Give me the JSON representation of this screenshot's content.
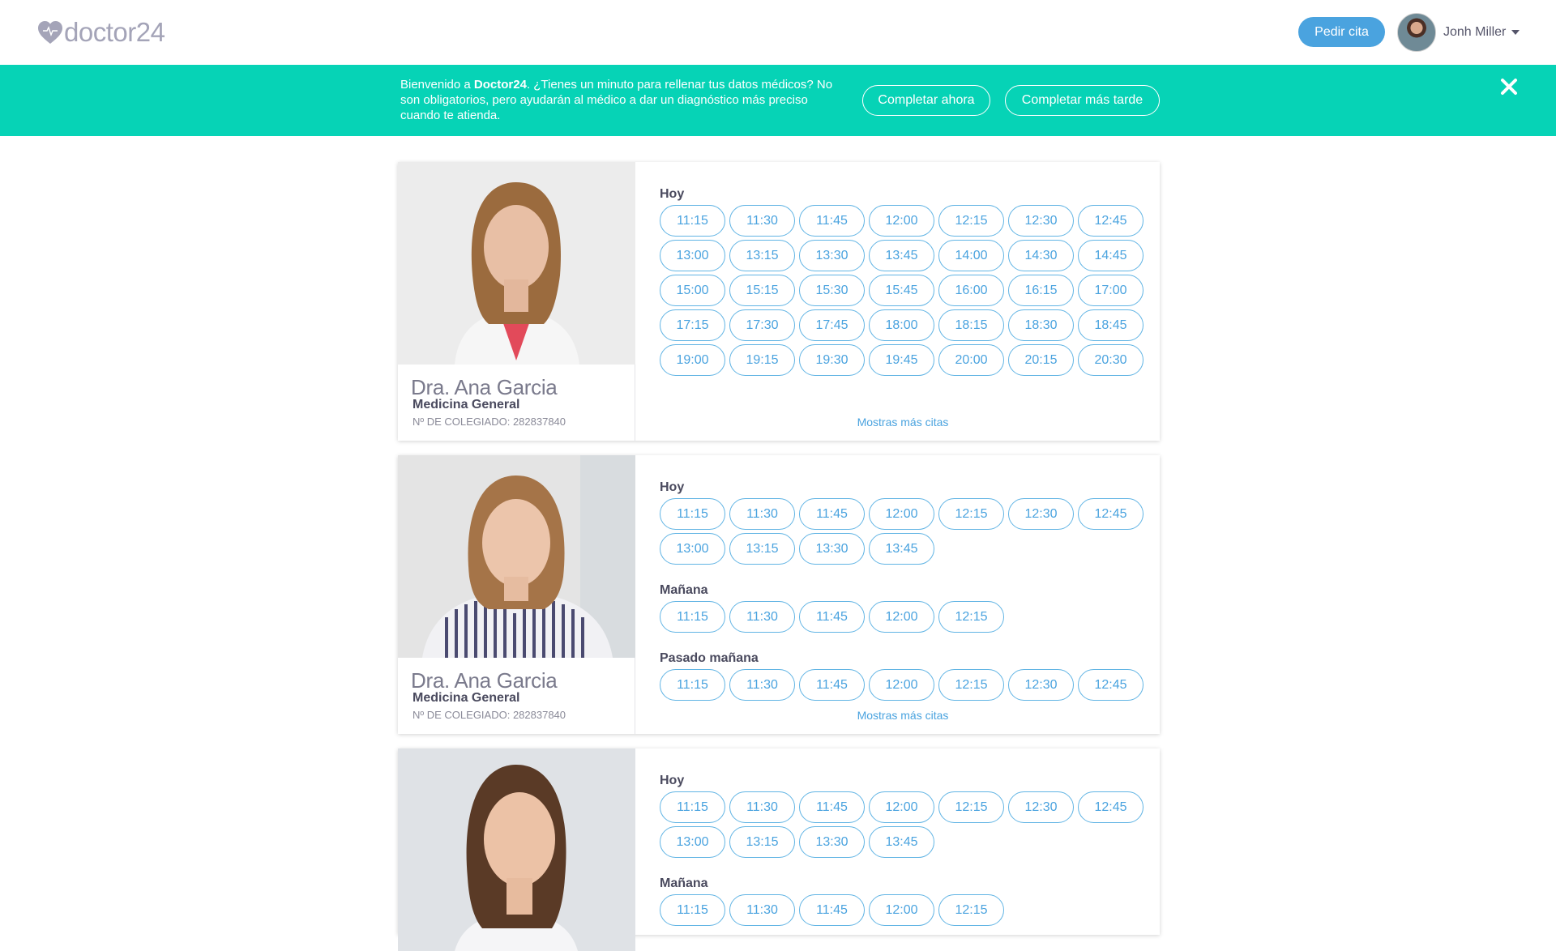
{
  "header": {
    "logo_text": "doctor24",
    "request_button": "Pedir cita",
    "user_name": "Jonh Miller",
    "colors": {
      "primary": "#4aa3df",
      "logo": "#a4a4b8"
    }
  },
  "banner": {
    "text_pre": "Bienvenido a ",
    "text_brand": "Doctor24",
    "text_post": ". ¿Tienes un minuto para rellenar tus datos médicos? No son obligatorios, pero ayudarán al médico a dar un diagnóstico más preciso cuando te atienda.",
    "complete_now": "Completar ahora",
    "complete_later": "Completar más tarde",
    "close_icon": "close-icon",
    "color": "#06d3b6"
  },
  "doctors": [
    {
      "name": "Dra. Ana Garcia",
      "specialty": "Medicina General",
      "license": "Nº DE COLEGIADO: 282837840",
      "more_link": "Mostras más citas",
      "days": [
        {
          "label": "Hoy",
          "slots": [
            "11:15",
            "11:30",
            "11:45",
            "12:00",
            "12:15",
            "12:30",
            "12:45",
            "13:00",
            "13:15",
            "13:30",
            "13:45",
            "14:00",
            "14:30",
            "14:45",
            "15:00",
            "15:15",
            "15:30",
            "15:45",
            "16:00",
            "16:15",
            "17:00",
            "17:15",
            "17:30",
            "17:45",
            "18:00",
            "18:15",
            "18:30",
            "18:45",
            "19:00",
            "19:15",
            "19:30",
            "19:45",
            "20:00",
            "20:15",
            "20:30"
          ]
        }
      ]
    },
    {
      "name": "Dra. Ana Garcia",
      "specialty": "Medicina General",
      "license": "Nº DE COLEGIADO: 282837840",
      "more_link": "Mostras más citas",
      "days": [
        {
          "label": "Hoy",
          "slots": [
            "11:15",
            "11:30",
            "11:45",
            "12:00",
            "12:15",
            "12:30",
            "12:45",
            "13:00",
            "13:15",
            "13:30",
            "13:45"
          ]
        },
        {
          "label": "Mañana",
          "slots": [
            "11:15",
            "11:30",
            "11:45",
            "12:00",
            "12:15"
          ]
        },
        {
          "label": "Pasado mañana",
          "slots": [
            "11:15",
            "11:30",
            "11:45",
            "12:00",
            "12:15",
            "12:30",
            "12:45"
          ]
        }
      ]
    },
    {
      "days": [
        {
          "label": "Hoy",
          "slots": [
            "11:15",
            "11:30",
            "11:45",
            "12:00",
            "12:15",
            "12:30",
            "12:45",
            "13:00",
            "13:15",
            "13:30",
            "13:45"
          ]
        },
        {
          "label": "Mañana",
          "slots": [
            "11:15",
            "11:30",
            "11:45",
            "12:00",
            "12:15"
          ]
        }
      ]
    }
  ]
}
